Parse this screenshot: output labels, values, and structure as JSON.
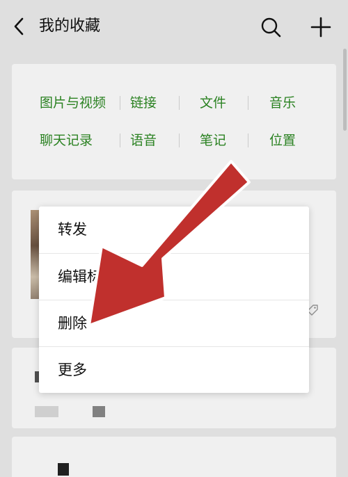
{
  "header": {
    "title": "我的收藏",
    "back_icon": "chevron-left-icon",
    "search_icon": "search-icon",
    "add_icon": "plus-icon"
  },
  "categories": {
    "row1": [
      "图片与视频",
      "链接",
      "文件",
      "音乐"
    ],
    "row2": [
      "聊天记录",
      "语音",
      "笔记",
      "位置"
    ]
  },
  "context_menu": {
    "items": [
      "转发",
      "编辑标",
      "删除",
      "更多"
    ]
  },
  "colors": {
    "accent_green": "#2e8b25",
    "background": "#ededed",
    "annotation_red": "#c0302d"
  }
}
